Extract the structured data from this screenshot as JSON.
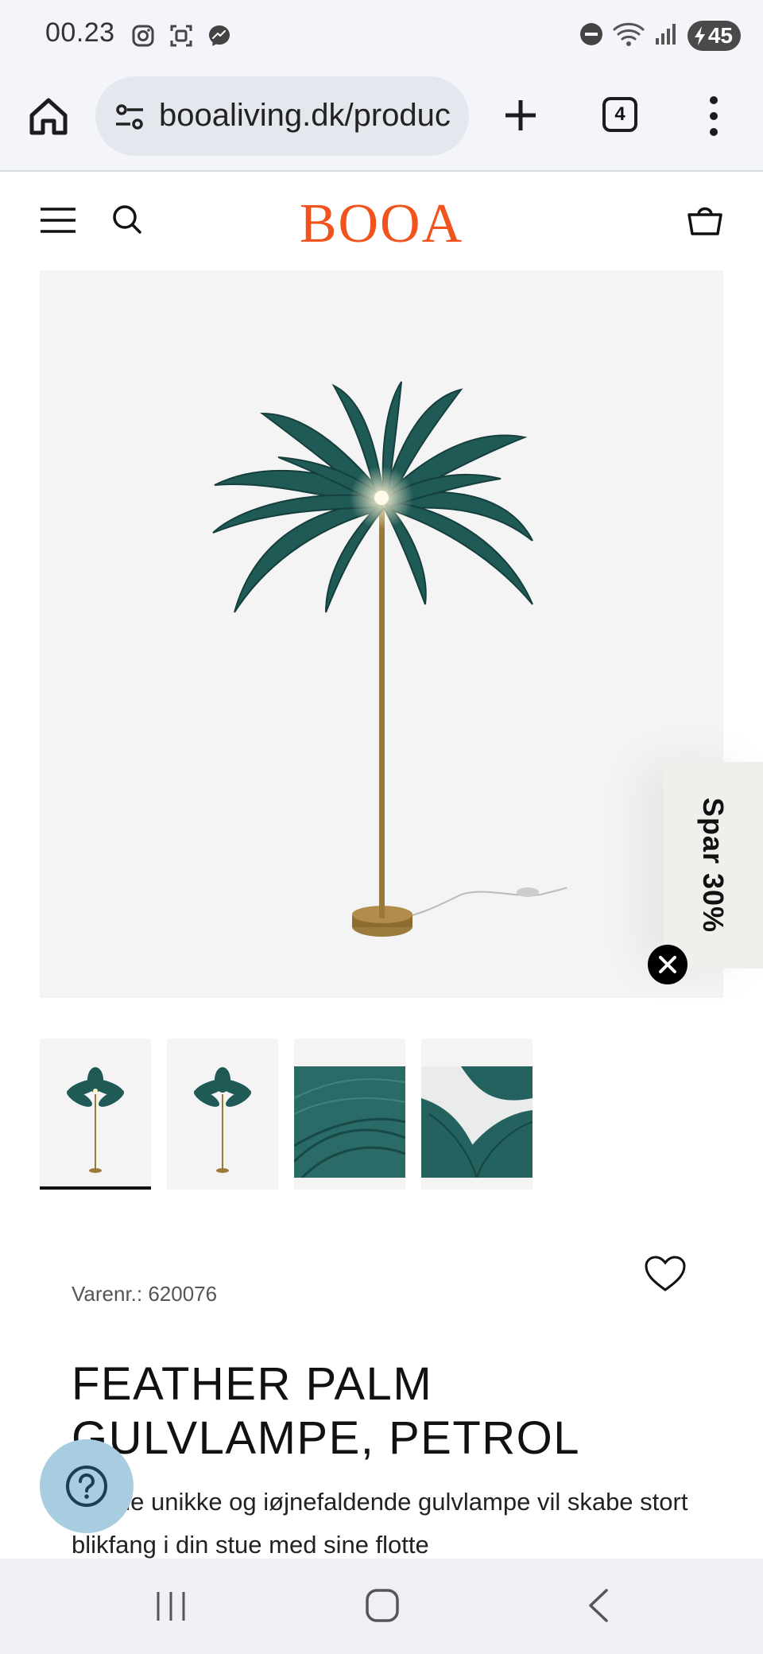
{
  "status_bar": {
    "time": "00.23",
    "battery": "45",
    "left_icons": [
      "instagram-icon",
      "screenshot-icon",
      "messenger-icon"
    ],
    "right_icons": [
      "do-not-disturb-icon",
      "wifi-icon",
      "signal-icon",
      "battery-icon"
    ]
  },
  "browser": {
    "url": "booaliving.dk/produc",
    "tab_count": "4"
  },
  "site": {
    "logo": "BOOA",
    "brand_color": "#f0531c"
  },
  "promo": {
    "label": "Spar 30%"
  },
  "product": {
    "sku": "Varenr.: 620076",
    "title": "FEATHER PALM GULVLAMPE, PETROL",
    "description": "Denne unikke og iøjnefaldende gulvlampe vil skabe stort blikfang i din stue med sine flotte",
    "feather_color": "#1f5a57",
    "thumbnails": [
      {
        "kind": "full-lamp",
        "active": true
      },
      {
        "kind": "full-lamp",
        "active": false
      },
      {
        "kind": "feather-closeup",
        "active": false
      },
      {
        "kind": "feather-closeup",
        "active": false
      }
    ]
  }
}
